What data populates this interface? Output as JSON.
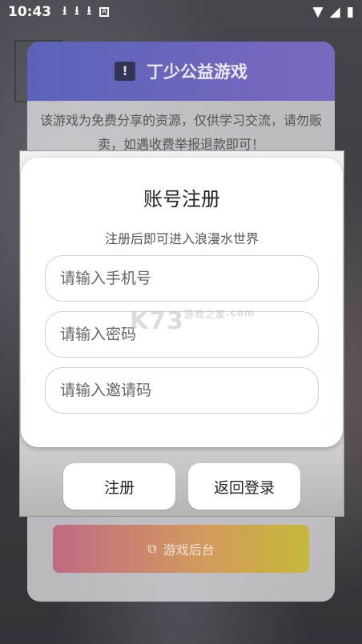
{
  "status_bar": {
    "time": "10:43",
    "icons": [
      "download-icon",
      "download-icon",
      "download-icon",
      "app-badge-icon",
      "wifi-icon",
      "signal-icon",
      "battery-icon"
    ]
  },
  "notice": {
    "title": "丁少公益游戏",
    "text": "该游戏为免费分享的资源，仅供学习交流，请勿贩卖，如遇收费举报退款即可！",
    "backend_label": "游戏后台"
  },
  "register": {
    "title": "账号注册",
    "subtitle": "注册后即可进入浪漫水世界",
    "phone_placeholder": "请输入手机号",
    "password_placeholder": "请输入密码",
    "invite_placeholder": "请输入邀请码"
  },
  "actions": {
    "register_label": "注册",
    "back_login_label": "返回登录"
  },
  "watermark": {
    "brand": "K73",
    "site": "游戏之家",
    "domain": ".com"
  },
  "colors": {
    "header_purple": "#6a66bc",
    "button_gradient_start": "#c06a84",
    "button_gradient_end": "#c6b83a"
  }
}
